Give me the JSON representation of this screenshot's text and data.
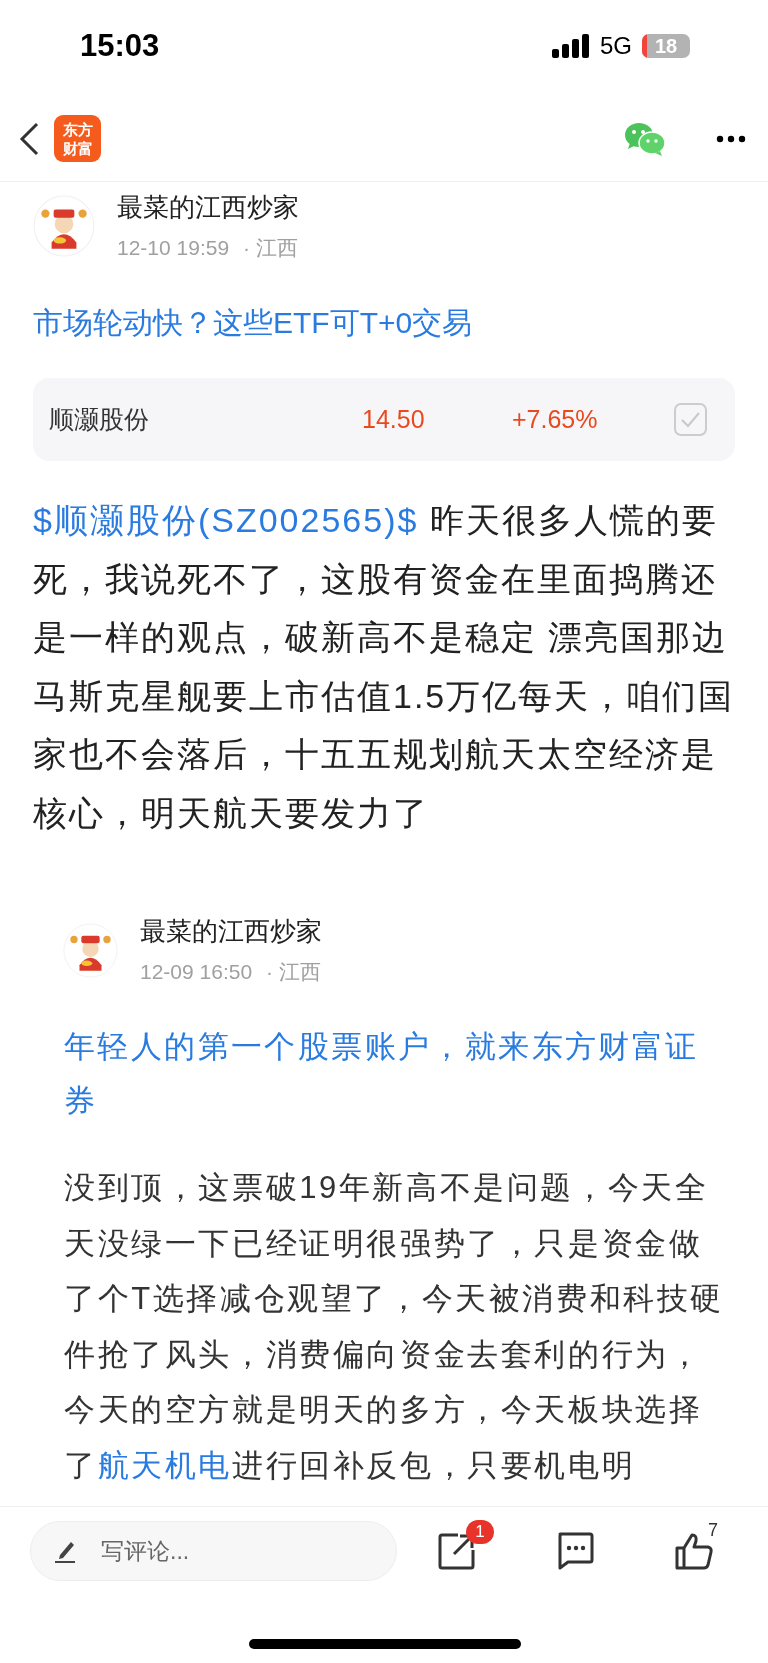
{
  "status_bar": {
    "time": "15:03",
    "network": "5G",
    "battery": "18"
  },
  "header": {
    "logo": [
      "东方",
      "财富"
    ]
  },
  "post": {
    "author": "最菜的江西炒家",
    "time": "12-10 19:59",
    "location": "· 江西",
    "title": "市场轮动快？这些ETF可T+0交易",
    "stock": {
      "name": "顺灏股份",
      "price": "14.50",
      "change": "+7.65%",
      "watchlisted": true
    },
    "body": [
      {
        "kind": "link",
        "text": "$顺灏股份(SZ002565)$"
      },
      {
        "kind": "text",
        "text": "  昨天很多人慌的要死，我说死不了，这股有资金在里面捣腾还是一样的观点，破新高不是稳定 漂亮国那边马斯克星舰要上市估值1.5万亿每天，咱们国家也不会落后，十五五规划航天太空经济是核心，明天航天要发力了"
      }
    ]
  },
  "quoted_post": {
    "author": "最菜的江西炒家",
    "time": "12-09 16:50",
    "location": "· 江西",
    "title": "年轻人的第一个股票账户，就来东方财富证券",
    "body": [
      {
        "kind": "text",
        "text": "没到顶，这票破19年新高不是问题，今天全天没绿一下已经证明很强势了，只是资金做了个T选择减仓观望了，今天被消费和科技硬件抢了风头，消费偏向资金去套利的行为，今天的空方就是明天的多方，今天板块选择了"
      },
      {
        "kind": "link",
        "text": "航天机电"
      },
      {
        "kind": "text",
        "text": "进行回补反包，只要机电明"
      }
    ]
  },
  "bottom_bar": {
    "comment": {
      "placeholder": "写评论..."
    },
    "share_badge": "1",
    "like_count": "7"
  }
}
